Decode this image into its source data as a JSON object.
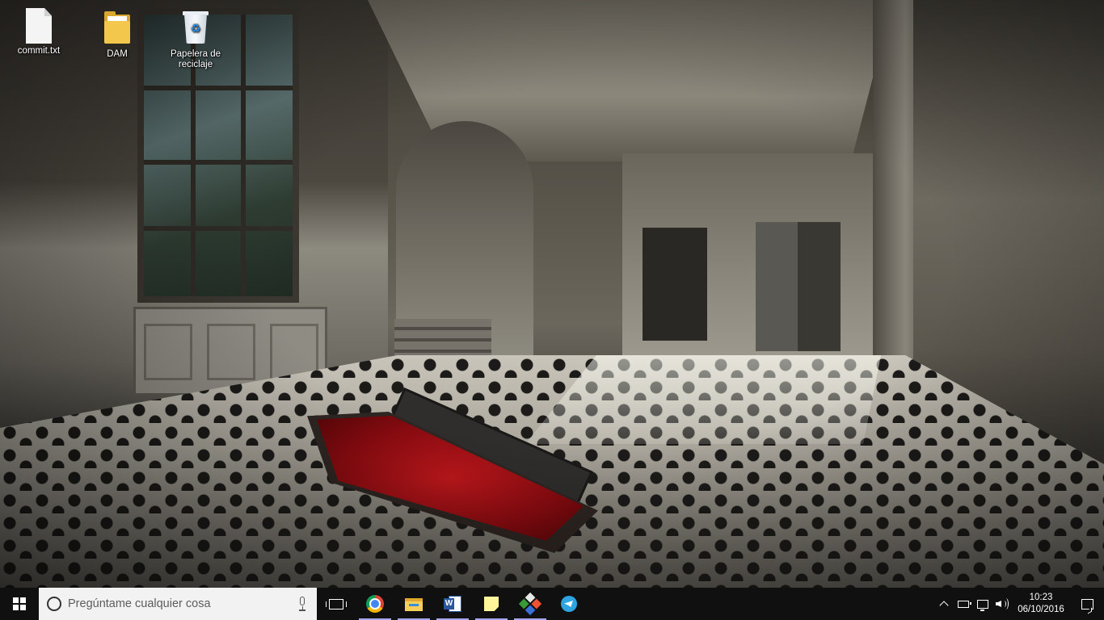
{
  "desktop": {
    "icons": [
      {
        "label": "commit.txt",
        "icon": "text-file-icon"
      },
      {
        "label": "DAM",
        "icon": "folder-icon"
      },
      {
        "label": "Papelera de reciclaje",
        "icon": "recycle-bin-icon"
      }
    ]
  },
  "taskbar": {
    "search": {
      "placeholder": "Pregúntame cualquier cosa"
    },
    "apps": [
      {
        "name": "chrome",
        "icon": "chrome-icon",
        "running": true
      },
      {
        "name": "file-explorer",
        "icon": "folder-icon",
        "running": true
      },
      {
        "name": "word",
        "icon": "word-icon",
        "running": true
      },
      {
        "name": "sticky-notes",
        "icon": "sticky-notes-icon",
        "running": true
      },
      {
        "name": "git",
        "icon": "git-icon",
        "running": true
      },
      {
        "name": "telegram",
        "icon": "telegram-icon",
        "running": false
      }
    ],
    "tray": {
      "time": "10:23",
      "date": "06/10/2016"
    }
  },
  "colors": {
    "taskbar": "#101010",
    "search_box": "#f2f2f2",
    "running_indicator": "#a7a7f0"
  }
}
